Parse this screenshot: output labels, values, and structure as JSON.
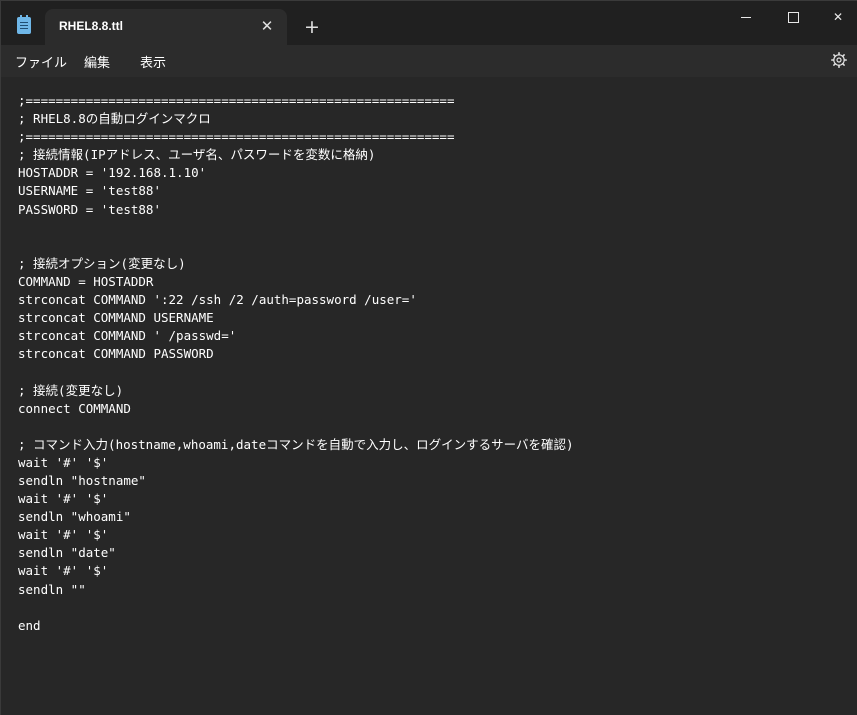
{
  "titlebar": {
    "tab_title": "RHEL8.8.ttl",
    "tab_close_symbol": "✕",
    "new_tab_symbol": "+",
    "minimize_icon": "minimize-icon",
    "maximize_icon": "maximize-icon",
    "close_symbol": "✕"
  },
  "menu": {
    "file": "ファイル",
    "edit": "編集",
    "view": "表示",
    "settings_icon": "gear-icon"
  },
  "editor": {
    "lines": [
      ";=========================================================",
      "; RHEL8.8の自動ログインマクロ",
      ";=========================================================",
      "; 接続情報(IPアドレス、ユーザ名、パスワードを変数に格納)",
      "HOSTADDR = '192.168.1.10'",
      "USERNAME = 'test88'",
      "PASSWORD = 'test88'",
      "",
      "",
      "; 接続オプション(変更なし)",
      "COMMAND = HOSTADDR",
      "strconcat COMMAND ':22 /ssh /2 /auth=password /user='",
      "strconcat COMMAND USERNAME",
      "strconcat COMMAND ' /passwd='",
      "strconcat COMMAND PASSWORD",
      "",
      "; 接続(変更なし)",
      "connect COMMAND",
      "",
      "; コマンド入力(hostname,whoami,dateコマンドを自動で入力し、ログインするサーバを確認)",
      "wait '#' '$'",
      "sendln \"hostname\"",
      "wait '#' '$'",
      "sendln \"whoami\"",
      "wait '#' '$'",
      "sendln \"date\"",
      "wait '#' '$'",
      "sendln \"\"",
      "",
      "end"
    ]
  },
  "colors": {
    "background": "#272727",
    "titlebar": "#202020",
    "tab": "#2c2c2c",
    "text": "#ffffff",
    "app_icon": "#6fb7e8"
  }
}
